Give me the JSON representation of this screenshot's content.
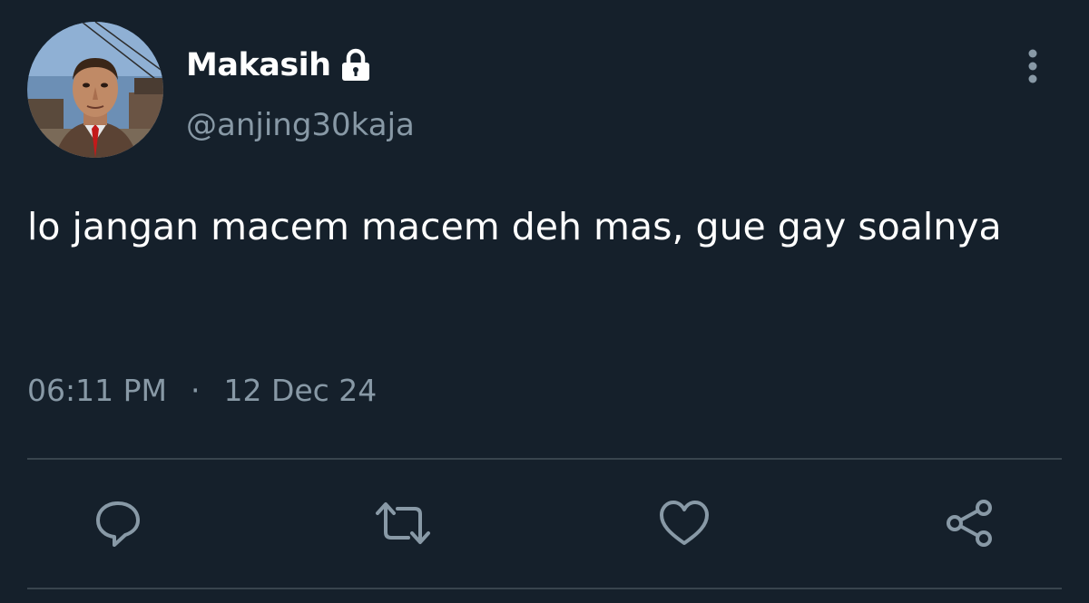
{
  "author": {
    "display_name": "Makasih",
    "handle": "@anjing30kaja",
    "avatar_icon": "avatar-photo",
    "protected_icon": "lock-icon"
  },
  "tweet": {
    "text": "lo jangan macem macem deh mas, gue gay soalnya",
    "time": "06:11 PM",
    "separator": "·",
    "date": "12 Dec 24"
  },
  "actions": [
    {
      "name": "reply",
      "icon": "reply-icon"
    },
    {
      "name": "retweet",
      "icon": "retweet-icon"
    },
    {
      "name": "like",
      "icon": "heart-icon"
    },
    {
      "name": "share",
      "icon": "share-icon"
    }
  ],
  "colors": {
    "background": "#15202b",
    "text_primary": "#ffffff",
    "text_secondary": "#8899a6",
    "divider": "#38444d"
  }
}
